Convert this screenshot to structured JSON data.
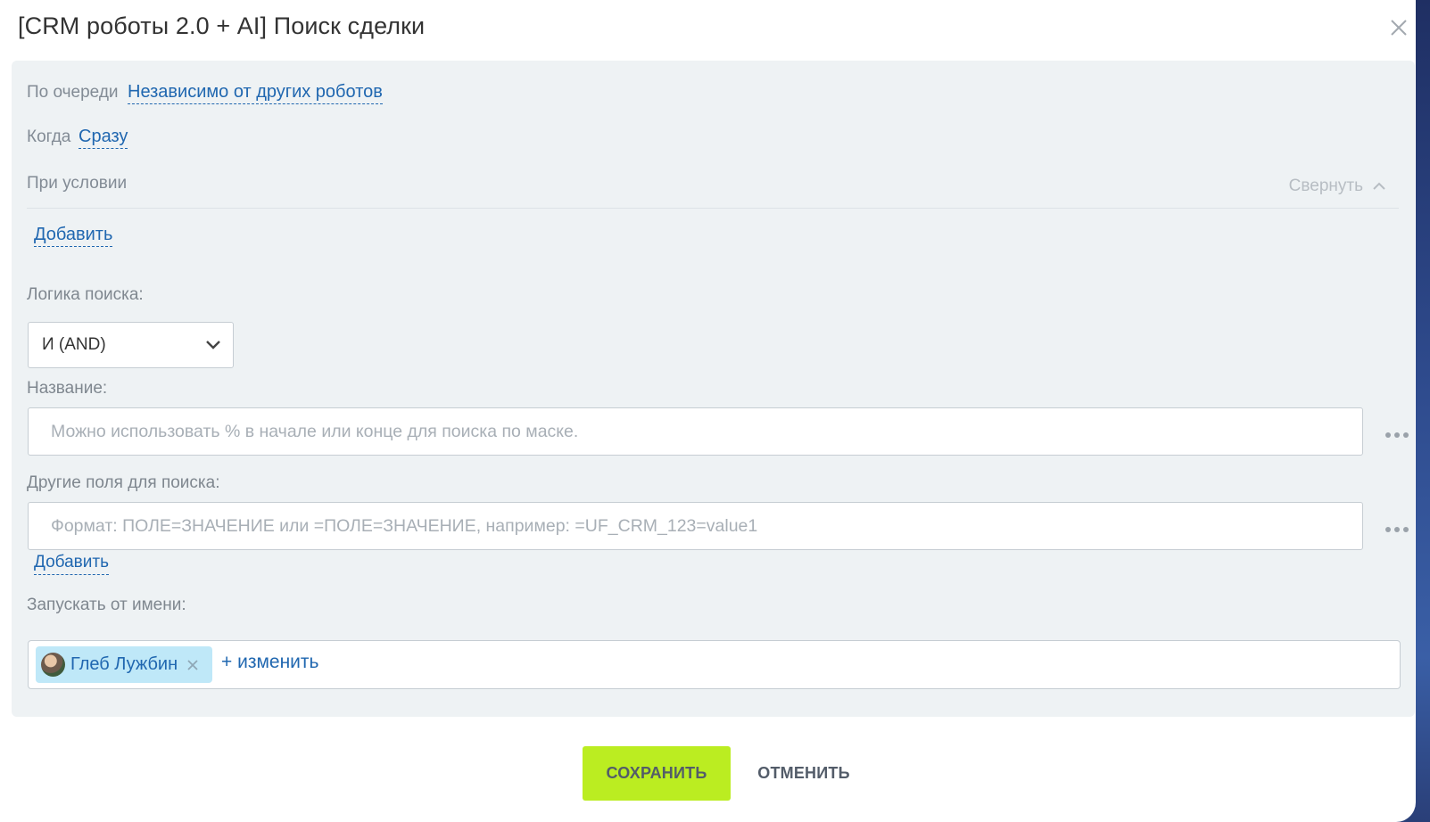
{
  "dialog": {
    "title": "[CRM роботы 2.0 + AI] Поиск сделки"
  },
  "queue": {
    "label": "По очереди",
    "value": "Независимо от других роботов"
  },
  "when": {
    "label": "Когда",
    "value": "Сразу"
  },
  "condition": {
    "label": "При условии",
    "collapse_label": "Свернуть",
    "add_label": "Добавить"
  },
  "search_logic": {
    "label": "Логика поиска:",
    "selected": "И (AND)"
  },
  "name_field": {
    "label": "Название:",
    "placeholder": "Можно использовать % в начале или конце для поиска по маске.",
    "value": ""
  },
  "other_fields": {
    "label": "Другие поля для поиска:",
    "placeholder": "Формат: ПОЛЕ=ЗНАЧЕНИЕ или =ПОЛЕ=ЗНАЧЕНИЕ, например: =UF_CRM_123=value1",
    "value": "",
    "add_label": "Добавить"
  },
  "run_as": {
    "label": "Запускать от имени:",
    "user_name": "Глеб Лужбин",
    "change_label": "+ изменить"
  },
  "footer": {
    "save_label": "СОХРАНИТЬ",
    "cancel_label": "ОТМЕНИТЬ"
  },
  "colors": {
    "link": "#2067b0",
    "panel_bg": "#eef2f4",
    "save_bg": "#bbed21",
    "chip_bg": "#bfe8f8"
  }
}
